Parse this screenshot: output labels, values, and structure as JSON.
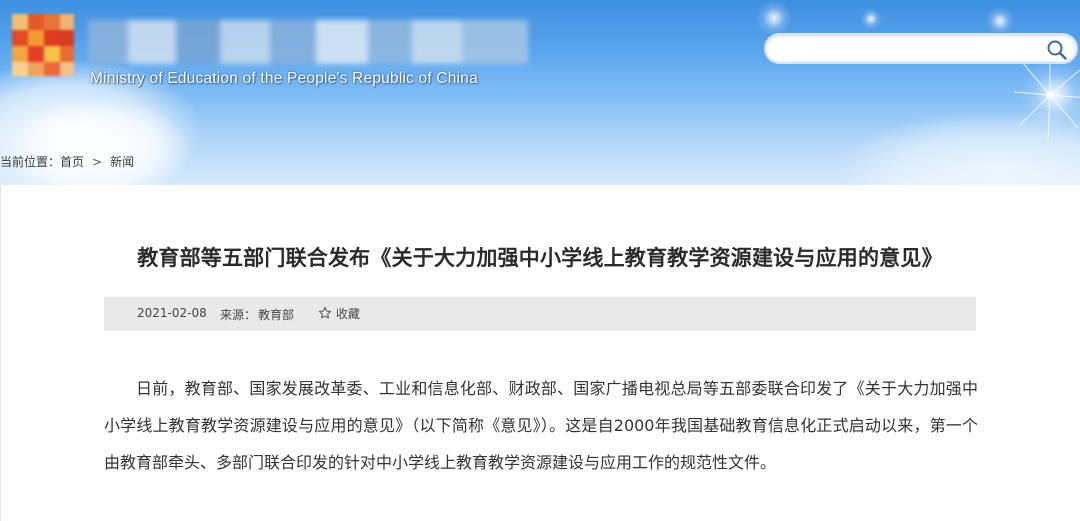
{
  "header": {
    "ministry_name_en": "Ministry of Education of the People's Republic of China",
    "search": {
      "placeholder": "",
      "value": ""
    }
  },
  "breadcrumb": {
    "label": "当前位置：",
    "items": [
      "首页",
      "新闻"
    ],
    "separator": ">"
  },
  "article": {
    "title": "教育部等五部门联合发布《关于大力加强中小学线上教育教学资源建设与应用的意见》",
    "date": "2021-02-08",
    "source_label": "来源：",
    "source": "教育部",
    "favorite_label": "收藏",
    "paragraph": "日前，教育部、国家发展改革委、工业和信息化部、财政部、国家广播电视总局等五部委联合印发了《关于大力加强中小学线上教育教学资源建设与应用的意见》（以下简称《意见》）。这是自2000年我国基础教育信息化正式启动以来，第一个由教育部牵头、多部门联合印发的针对中小学线上教育教学资源建设与应用工作的规范性文件。"
  },
  "colors": {
    "header_top": "#3d8fe0",
    "header_bottom": "#d6e9fb",
    "meta_bar": "#e9e9e9",
    "title_text": "#2b2b2b"
  }
}
